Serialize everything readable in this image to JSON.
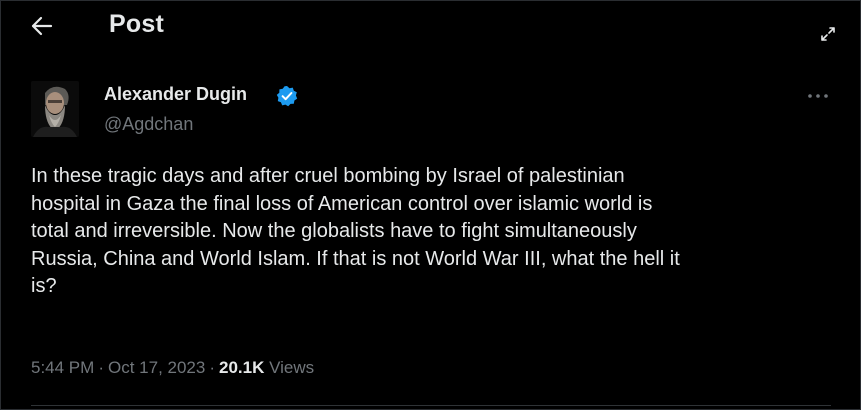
{
  "header": {
    "title": "Post",
    "back_icon": "arrow-left-icon",
    "expand_icon": "expand-arrows-icon"
  },
  "author": {
    "name": "Alexander Dugin",
    "handle": "@Agdchan",
    "verified": true,
    "verified_color": "#1d9bf0"
  },
  "post": {
    "text_lines": [
      "In these tragic days and after cruel bombing by Israel of palestinian",
      "hospital in Gaza the final loss of American control over islamic world is",
      "total and irreversible. Now the globalists have to fight simultaneously",
      "Russia, China and World Islam. If that is not World War III, what the hell it",
      "is?"
    ],
    "time": "5:44 PM",
    "date": "Oct 17, 2023",
    "views_count": "20.1K",
    "views_label": "Views"
  },
  "colors": {
    "background": "#000000",
    "text_primary": "#e7e9ea",
    "text_secondary": "#71767b",
    "accent": "#1d9bf0"
  }
}
